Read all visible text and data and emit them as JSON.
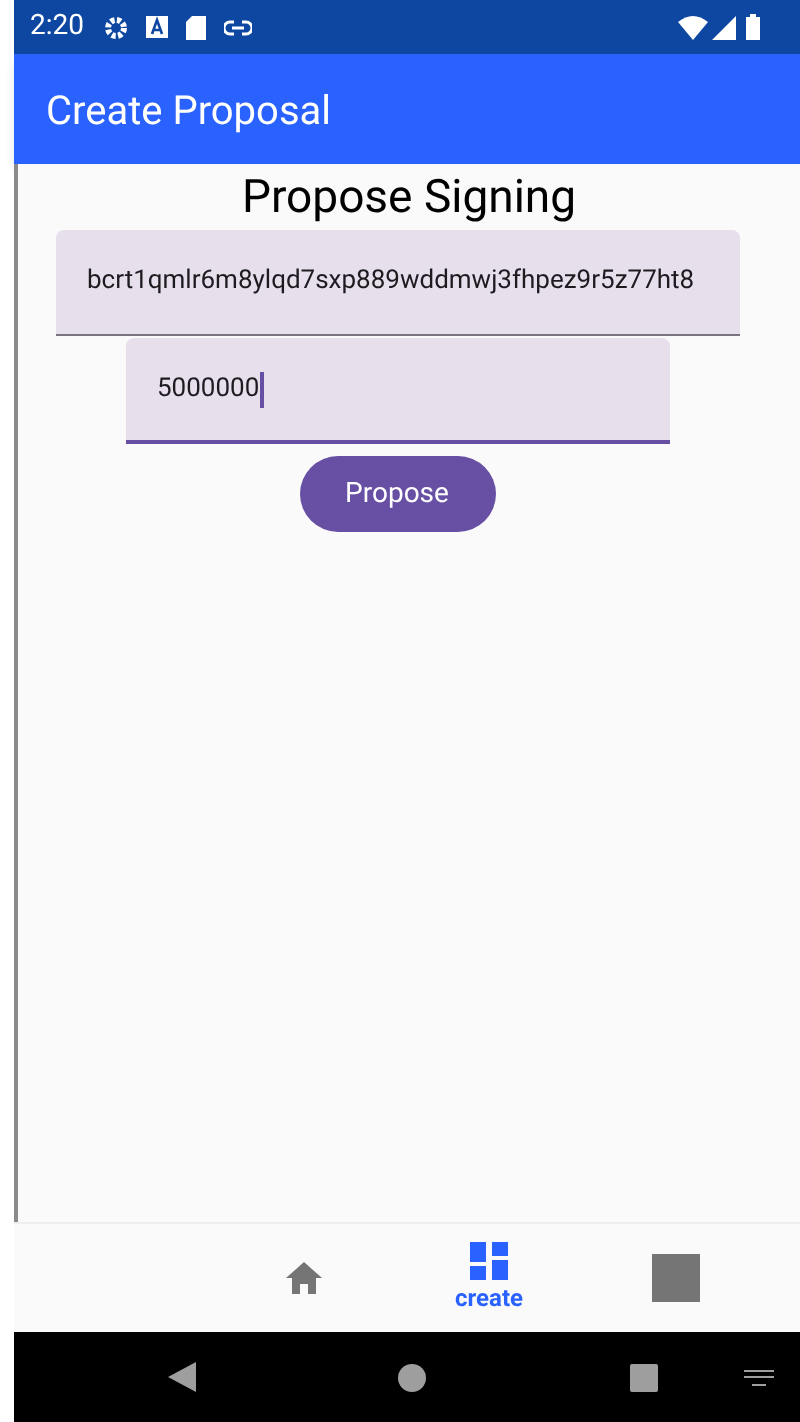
{
  "status_bar": {
    "time": "2:20"
  },
  "app_bar": {
    "title": "Create Proposal"
  },
  "form": {
    "heading": "Propose Signing",
    "fields": [
      {
        "value": "bcrt1qmlr6m8ylqd7sxp889wddmwj3fhpez9r5z77ht8",
        "focused": false
      },
      {
        "value": "5000000",
        "focused": true
      }
    ],
    "button": "Propose"
  },
  "bottom_nav": [
    {
      "kind": "home",
      "selected": false
    },
    {
      "kind": "dashboard",
      "label": "create",
      "selected": true
    },
    {
      "kind": "square",
      "selected": false
    }
  ]
}
